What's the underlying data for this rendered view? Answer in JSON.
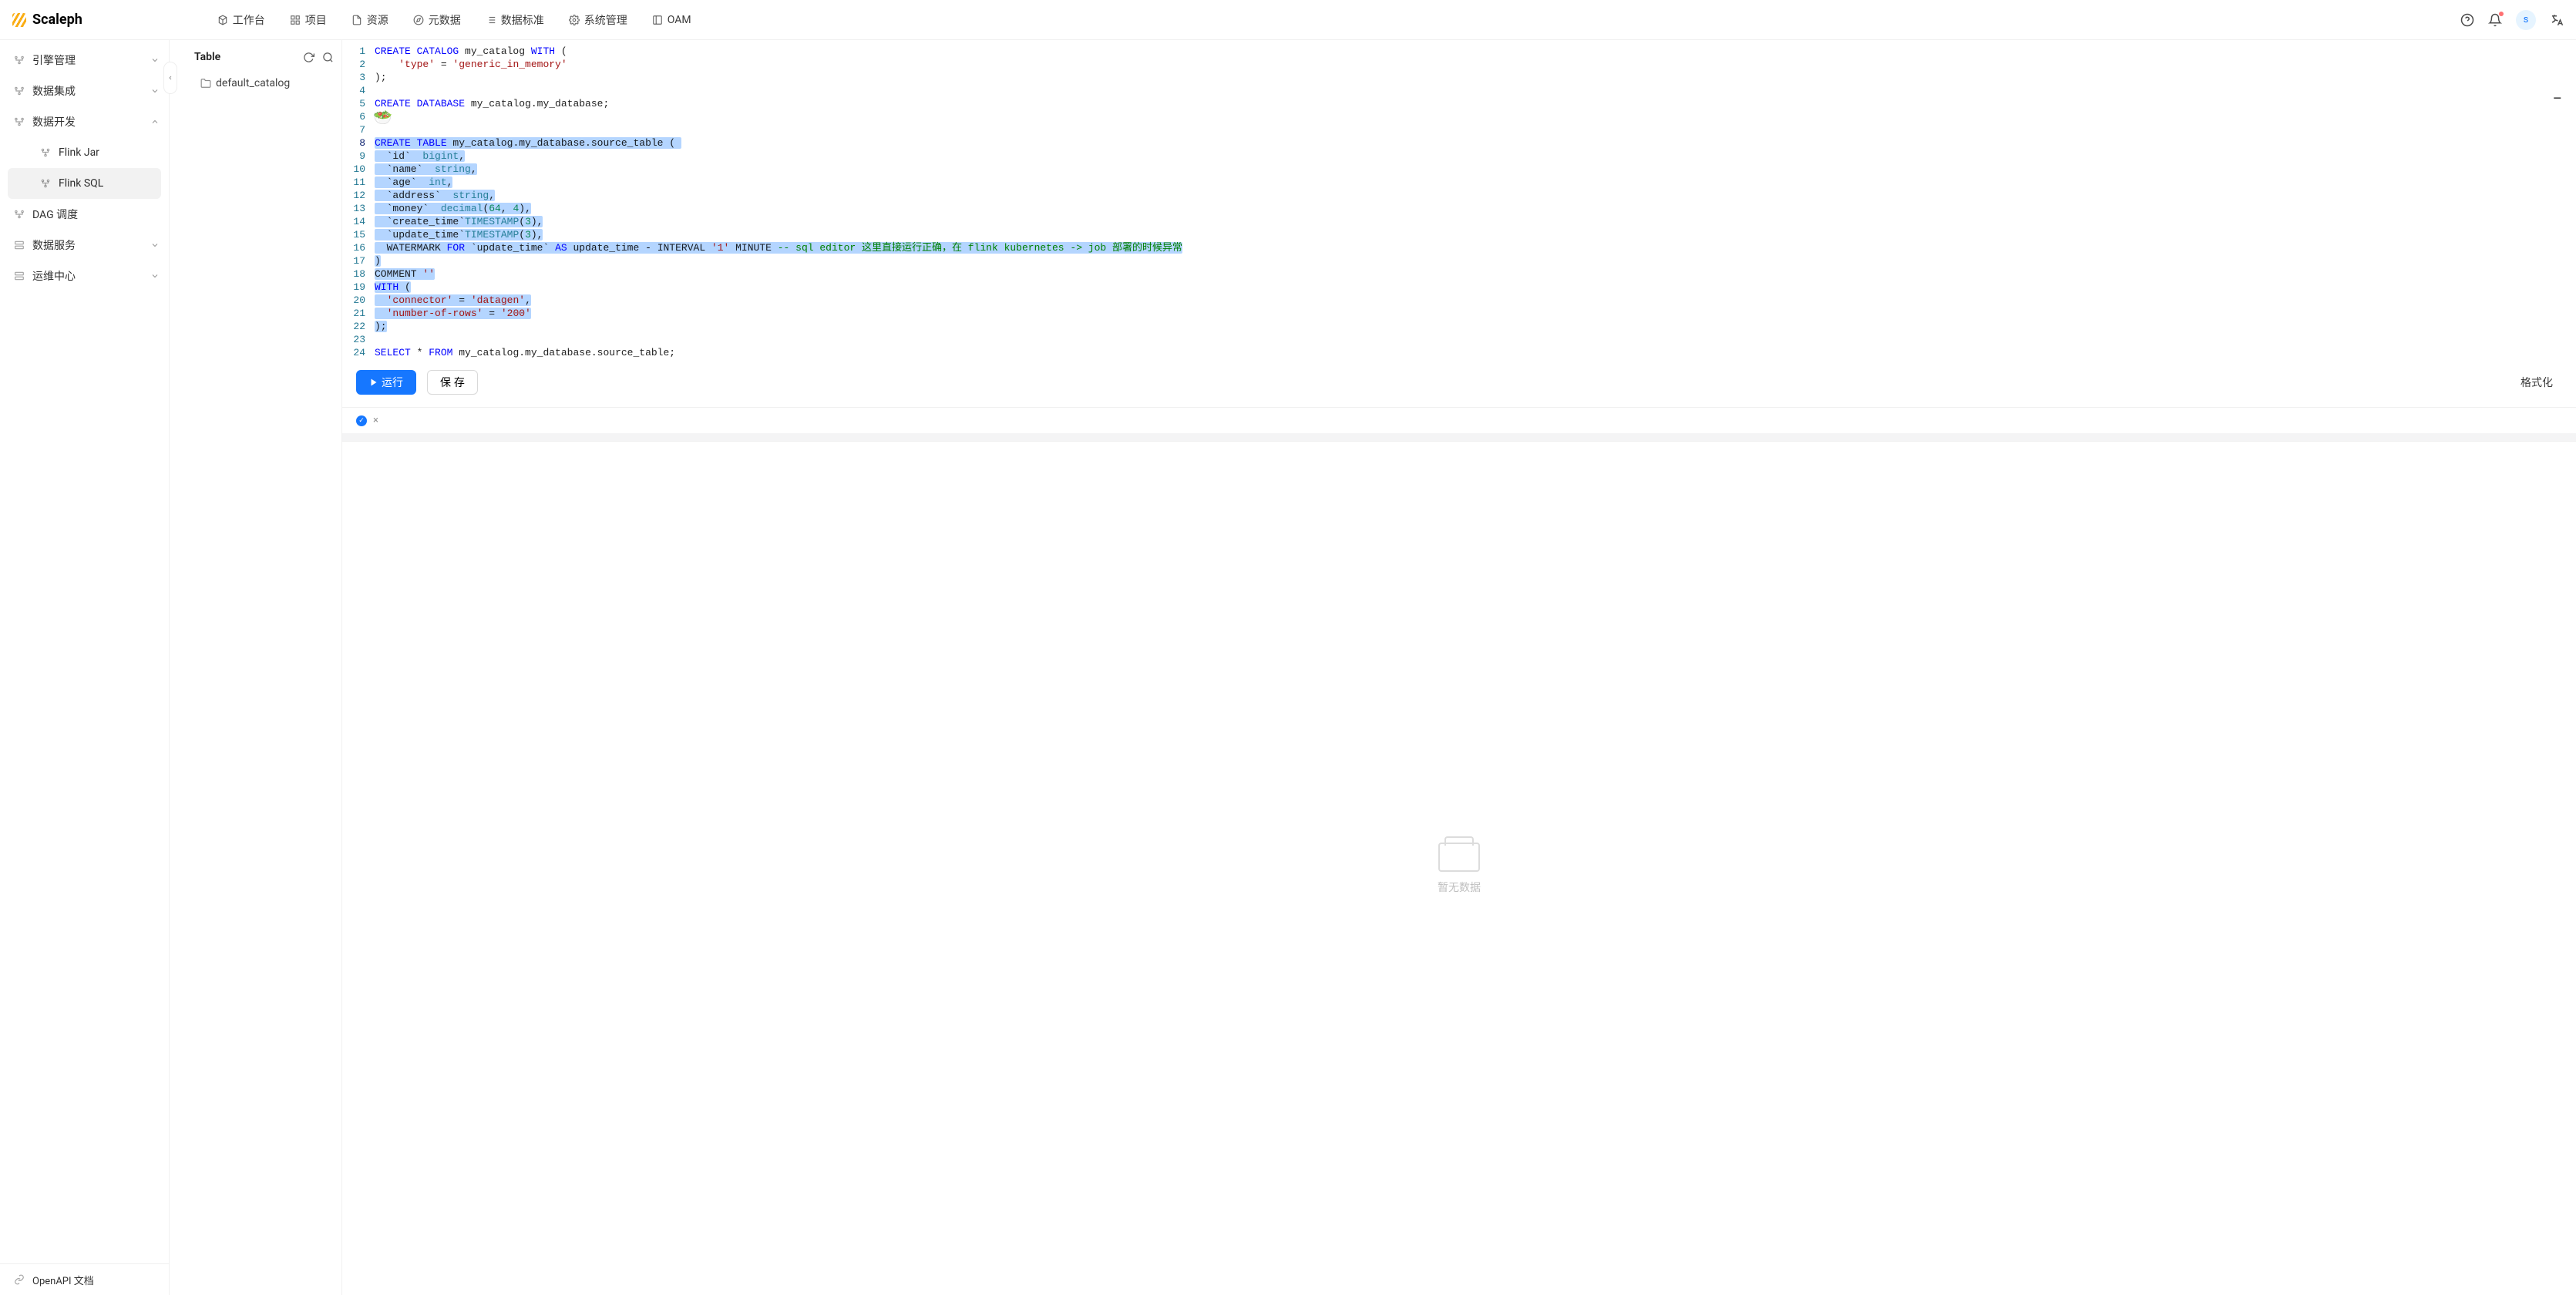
{
  "brand": "Scaleph",
  "topnav": [
    {
      "label": "工作台"
    },
    {
      "label": "项目"
    },
    {
      "label": "资源"
    },
    {
      "label": "元数据"
    },
    {
      "label": "数据标准"
    },
    {
      "label": "系统管理"
    },
    {
      "label": "OAM"
    }
  ],
  "avatar_initial": "s",
  "sidebar": {
    "sections": [
      {
        "label": "引擎管理",
        "expandable": true,
        "open": false
      },
      {
        "label": "数据集成",
        "expandable": true,
        "open": false
      },
      {
        "label": "数据开发",
        "expandable": true,
        "open": true,
        "children": [
          {
            "label": "Flink Jar",
            "active": false
          },
          {
            "label": "Flink SQL",
            "active": true
          }
        ]
      },
      {
        "label": "DAG 调度",
        "expandable": false
      },
      {
        "label": "数据服务",
        "expandable": true,
        "open": false
      },
      {
        "label": "运维中心",
        "expandable": true,
        "open": false
      }
    ],
    "footer": {
      "label": "OpenAPI 文档"
    }
  },
  "tree": {
    "title": "Table",
    "items": [
      {
        "label": "default_catalog"
      }
    ]
  },
  "editor": {
    "line_count": 24,
    "current_line": 8,
    "lines": {
      "l1": {
        "a": "CREATE CATALOG",
        "b": " my_catalog ",
        "c": "WITH",
        "d": " ("
      },
      "l2": {
        "a": "    ",
        "b": "'type'",
        "c": " = ",
        "d": "'generic_in_memory'"
      },
      "l3": {
        "a": ");"
      },
      "l5": {
        "a": "CREATE DATABASE",
        "b": " my_catalog.my_database;"
      },
      "l8": {
        "a": "CREATE TABLE",
        "b": " my_catalog.my_database.source_table ",
        "c": "("
      },
      "l9": {
        "a": "  `id` ",
        "b": " bigint",
        "c": ","
      },
      "l10": {
        "a": "  `name` ",
        "b": " string",
        "c": ","
      },
      "l11": {
        "a": "  `age` ",
        "b": " int",
        "c": ","
      },
      "l12": {
        "a": "  `address` ",
        "b": " string",
        "c": ","
      },
      "l13": {
        "a": "  `money` ",
        "b": " decimal",
        "c": "(",
        "d": "64",
        "e": ", ",
        "f": "4",
        "g": "),"
      },
      "l14": {
        "a": "  `create_time`",
        "b": "TIMESTAMP",
        "c": "(",
        "d": "3",
        "e": "),"
      },
      "l15": {
        "a": "  `update_time`",
        "b": "TIMESTAMP",
        "c": "(",
        "d": "3",
        "e": "),"
      },
      "l16": {
        "a": "  WATERMARK ",
        "b": "FOR",
        "c": " `update_time` ",
        "d": "AS",
        "e": " update_time ",
        "f": "-",
        "g": " INTERVAL ",
        "h": "'1'",
        "i": " MINUTE ",
        "j": "-- sql editor 这里直接运行正确，在 flink kubernetes -> job 部署的时候异常"
      },
      "l17": {
        "a": ")"
      },
      "l18": {
        "a": "COMMENT ",
        "b": "''"
      },
      "l19": {
        "a": "WITH",
        "b": " ("
      },
      "l20": {
        "a": "  ",
        "b": "'connector'",
        "c": " = ",
        "d": "'datagen'",
        "e": ","
      },
      "l21": {
        "a": "  ",
        "b": "'number-of-rows'",
        "c": " = ",
        "d": "'200'"
      },
      "l22": {
        "a": ");"
      },
      "l24": {
        "a": "SELECT",
        "b": " * ",
        "c": "FROM",
        "d": " my_catalog.my_database.source_table;"
      }
    }
  },
  "actions": {
    "run": "运行",
    "save": "保 存",
    "format": "格式化"
  },
  "result_tabs": {
    "close": "×"
  },
  "empty_text": "暂无数据"
}
